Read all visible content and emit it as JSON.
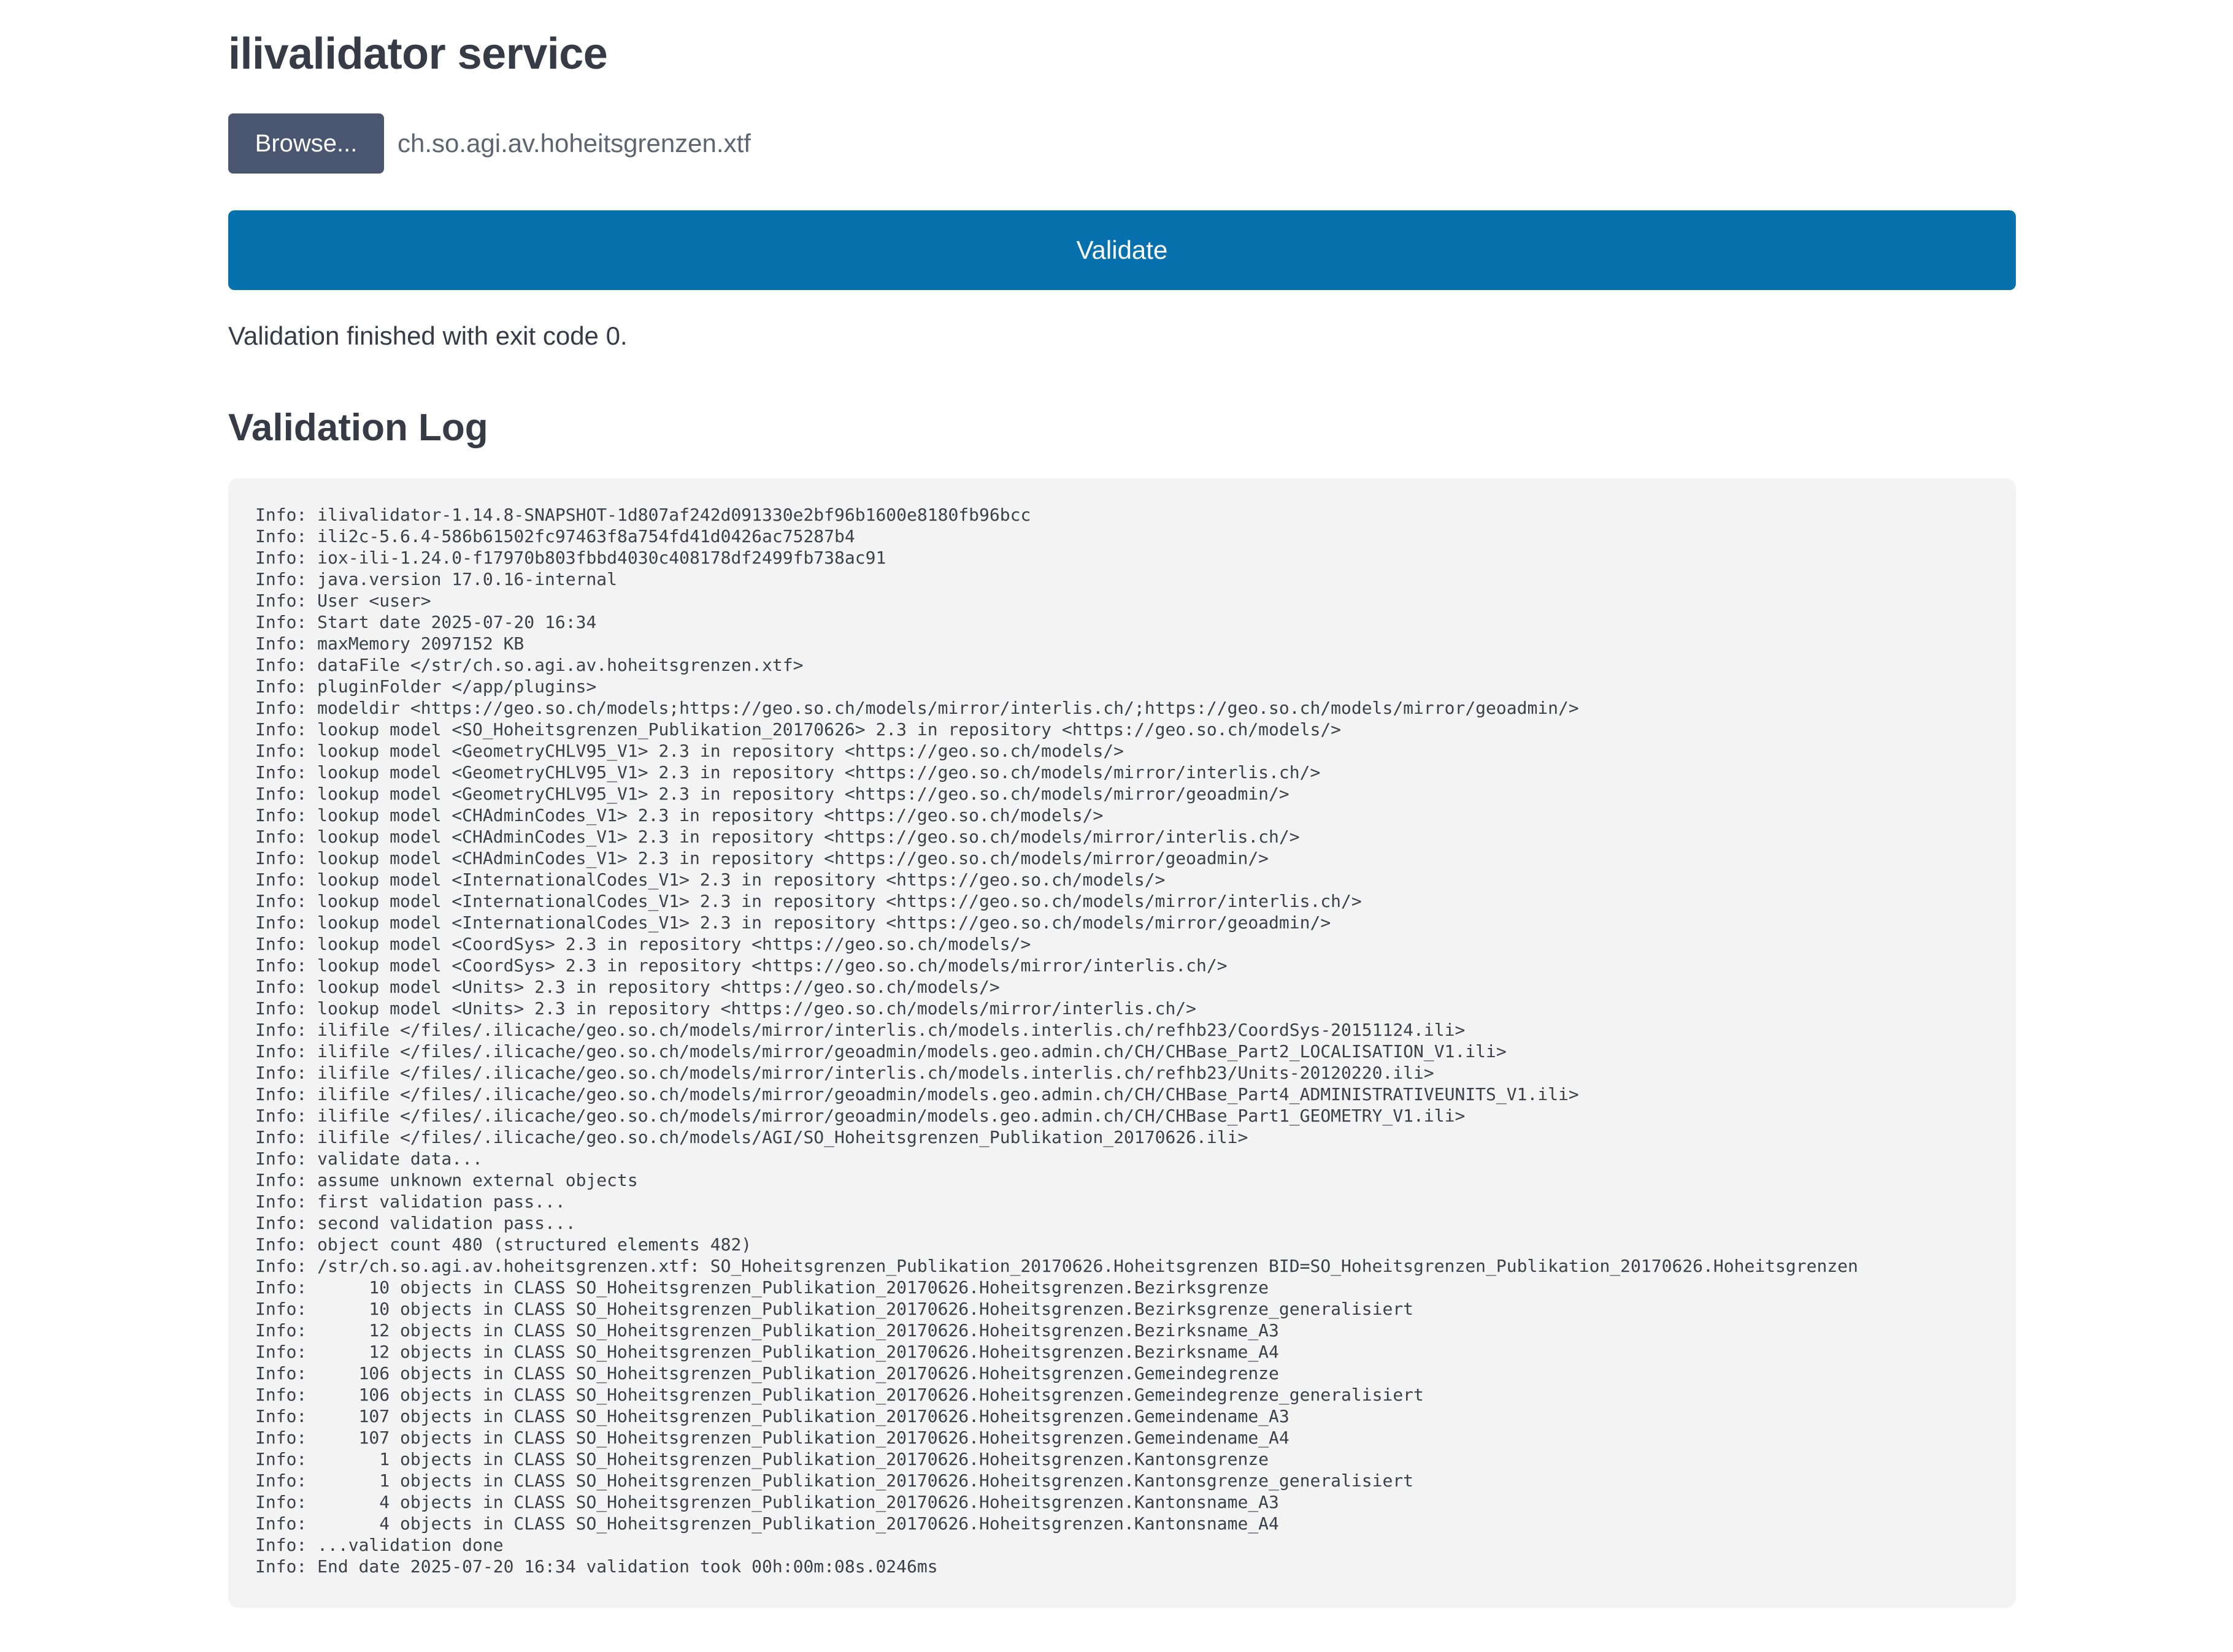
{
  "page": {
    "title": "ilivalidator service"
  },
  "file_input": {
    "browse_label": "Browse...",
    "file_name": "ch.so.agi.av.hoheitsgrenzen.xtf"
  },
  "validate_button": {
    "label": "Validate"
  },
  "status": {
    "message": "Validation finished with exit code 0."
  },
  "log": {
    "heading": "Validation Log",
    "lines": [
      "Info: ilivalidator-1.14.8-SNAPSHOT-1d807af242d091330e2bf96b1600e8180fb96bcc",
      "Info: ili2c-5.6.4-586b61502fc97463f8a754fd41d0426ac75287b4",
      "Info: iox-ili-1.24.0-f17970b803fbbd4030c408178df2499fb738ac91",
      "Info: java.version 17.0.16-internal",
      "Info: User <user>",
      "Info: Start date 2025-07-20 16:34",
      "Info: maxMemory 2097152 KB",
      "Info: dataFile </str/ch.so.agi.av.hoheitsgrenzen.xtf>",
      "Info: pluginFolder </app/plugins>",
      "Info: modeldir <https://geo.so.ch/models;https://geo.so.ch/models/mirror/interlis.ch/;https://geo.so.ch/models/mirror/geoadmin/>",
      "Info: lookup model <SO_Hoheitsgrenzen_Publikation_20170626> 2.3 in repository <https://geo.so.ch/models/>",
      "Info: lookup model <GeometryCHLV95_V1> 2.3 in repository <https://geo.so.ch/models/>",
      "Info: lookup model <GeometryCHLV95_V1> 2.3 in repository <https://geo.so.ch/models/mirror/interlis.ch/>",
      "Info: lookup model <GeometryCHLV95_V1> 2.3 in repository <https://geo.so.ch/models/mirror/geoadmin/>",
      "Info: lookup model <CHAdminCodes_V1> 2.3 in repository <https://geo.so.ch/models/>",
      "Info: lookup model <CHAdminCodes_V1> 2.3 in repository <https://geo.so.ch/models/mirror/interlis.ch/>",
      "Info: lookup model <CHAdminCodes_V1> 2.3 in repository <https://geo.so.ch/models/mirror/geoadmin/>",
      "Info: lookup model <InternationalCodes_V1> 2.3 in repository <https://geo.so.ch/models/>",
      "Info: lookup model <InternationalCodes_V1> 2.3 in repository <https://geo.so.ch/models/mirror/interlis.ch/>",
      "Info: lookup model <InternationalCodes_V1> 2.3 in repository <https://geo.so.ch/models/mirror/geoadmin/>",
      "Info: lookup model <CoordSys> 2.3 in repository <https://geo.so.ch/models/>",
      "Info: lookup model <CoordSys> 2.3 in repository <https://geo.so.ch/models/mirror/interlis.ch/>",
      "Info: lookup model <Units> 2.3 in repository <https://geo.so.ch/models/>",
      "Info: lookup model <Units> 2.3 in repository <https://geo.so.ch/models/mirror/interlis.ch/>",
      "Info: ilifile </files/.ilicache/geo.so.ch/models/mirror/interlis.ch/models.interlis.ch/refhb23/CoordSys-20151124.ili>",
      "Info: ilifile </files/.ilicache/geo.so.ch/models/mirror/geoadmin/models.geo.admin.ch/CH/CHBase_Part2_LOCALISATION_V1.ili>",
      "Info: ilifile </files/.ilicache/geo.so.ch/models/mirror/interlis.ch/models.interlis.ch/refhb23/Units-20120220.ili>",
      "Info: ilifile </files/.ilicache/geo.so.ch/models/mirror/geoadmin/models.geo.admin.ch/CH/CHBase_Part4_ADMINISTRATIVEUNITS_V1.ili>",
      "Info: ilifile </files/.ilicache/geo.so.ch/models/mirror/geoadmin/models.geo.admin.ch/CH/CHBase_Part1_GEOMETRY_V1.ili>",
      "Info: ilifile </files/.ilicache/geo.so.ch/models/AGI/SO_Hoheitsgrenzen_Publikation_20170626.ili>",
      "Info: validate data...",
      "Info: assume unknown external objects",
      "Info: first validation pass...",
      "Info: second validation pass...",
      "Info: object count 480 (structured elements 482)",
      "Info: /str/ch.so.agi.av.hoheitsgrenzen.xtf: SO_Hoheitsgrenzen_Publikation_20170626.Hoheitsgrenzen BID=SO_Hoheitsgrenzen_Publikation_20170626.Hoheitsgrenzen",
      "Info:      10 objects in CLASS SO_Hoheitsgrenzen_Publikation_20170626.Hoheitsgrenzen.Bezirksgrenze",
      "Info:      10 objects in CLASS SO_Hoheitsgrenzen_Publikation_20170626.Hoheitsgrenzen.Bezirksgrenze_generalisiert",
      "Info:      12 objects in CLASS SO_Hoheitsgrenzen_Publikation_20170626.Hoheitsgrenzen.Bezirksname_A3",
      "Info:      12 objects in CLASS SO_Hoheitsgrenzen_Publikation_20170626.Hoheitsgrenzen.Bezirksname_A4",
      "Info:     106 objects in CLASS SO_Hoheitsgrenzen_Publikation_20170626.Hoheitsgrenzen.Gemeindegrenze",
      "Info:     106 objects in CLASS SO_Hoheitsgrenzen_Publikation_20170626.Hoheitsgrenzen.Gemeindegrenze_generalisiert",
      "Info:     107 objects in CLASS SO_Hoheitsgrenzen_Publikation_20170626.Hoheitsgrenzen.Gemeindename_A3",
      "Info:     107 objects in CLASS SO_Hoheitsgrenzen_Publikation_20170626.Hoheitsgrenzen.Gemeindename_A4",
      "Info:       1 objects in CLASS SO_Hoheitsgrenzen_Publikation_20170626.Hoheitsgrenzen.Kantonsgrenze",
      "Info:       1 objects in CLASS SO_Hoheitsgrenzen_Publikation_20170626.Hoheitsgrenzen.Kantonsgrenze_generalisiert",
      "Info:       4 objects in CLASS SO_Hoheitsgrenzen_Publikation_20170626.Hoheitsgrenzen.Kantonsname_A3",
      "Info:       4 objects in CLASS SO_Hoheitsgrenzen_Publikation_20170626.Hoheitsgrenzen.Kantonsname_A4",
      "Info: ...validation done",
      "Info: End date 2025-07-20 16:34 validation took 00h:00m:08s.0246ms"
    ]
  },
  "colors": {
    "validate_button_bg": "#0671ad",
    "browse_button_bg": "#4a5570",
    "log_background": "#f3f3f3",
    "text": "#363b45"
  }
}
